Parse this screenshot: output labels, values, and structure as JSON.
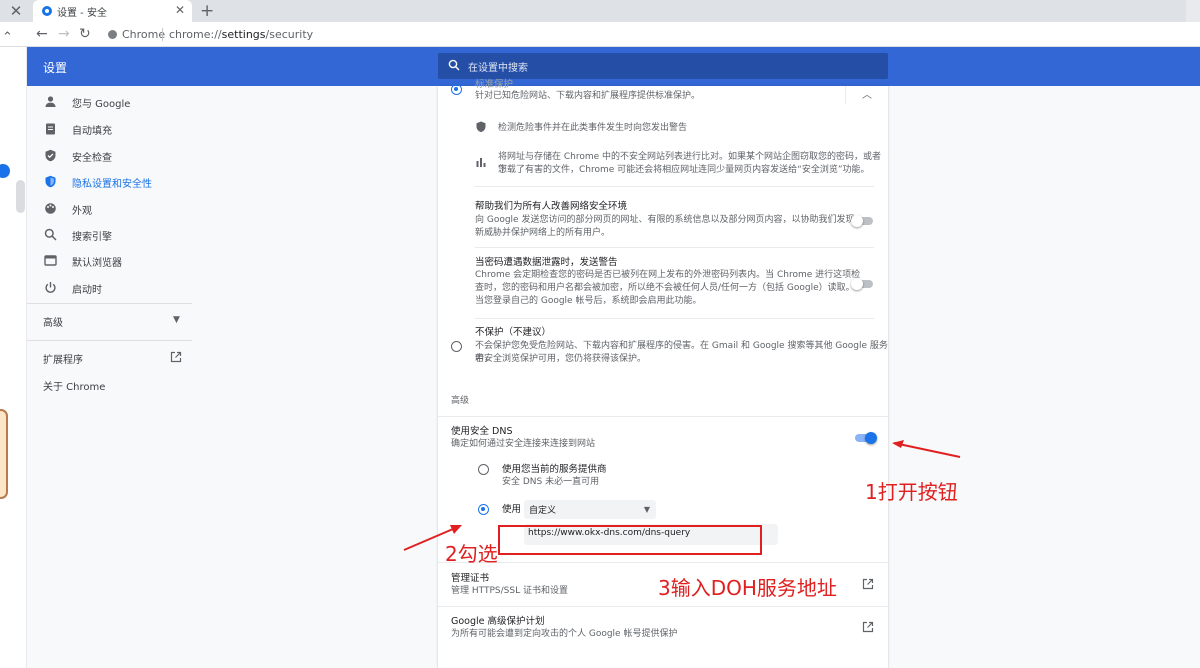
{
  "browser": {
    "tab_title": "设置 - 安全",
    "new_tab_symbol": "+",
    "close_symbol": "✕",
    "omnibox": {
      "site": "Chrome",
      "url_prefix": "chrome://",
      "url_path": "settings",
      "url_suffix": "/security"
    }
  },
  "header": {
    "title": "设置",
    "search_placeholder": "在设置中搜索"
  },
  "sidebar": {
    "items": [
      {
        "label": "您与 Google",
        "icon": "person-icon"
      },
      {
        "label": "自动填充",
        "icon": "clipboard-icon"
      },
      {
        "label": "安全检查",
        "icon": "shield-check-icon"
      },
      {
        "label": "隐私设置和安全性",
        "icon": "shield-icon",
        "active": true
      },
      {
        "label": "外观",
        "icon": "palette-icon"
      },
      {
        "label": "搜索引擎",
        "icon": "search-icon"
      },
      {
        "label": "默认浏览器",
        "icon": "browser-icon"
      },
      {
        "label": "启动时",
        "icon": "power-icon"
      }
    ],
    "advanced": "高级",
    "extensions": "扩展程序",
    "about": "关于 Chrome"
  },
  "security": {
    "standard": {
      "title_partial": "标准保护",
      "desc": "针对已知危险网站、下载内容和扩展程序提供标准保护。",
      "bullet1": "检测危险事件并在此类事件发生时向您发出警告",
      "bullet2_line1": "将网址与存储在 Chrome 中的不安全网站列表进行比对。如果某个网站企图窃取您的密码，或者您",
      "bullet2_line2": "下载了有害的文件，Chrome 可能还会将相应网址连同少量网页内容发送给“安全浏览”功能。"
    },
    "help_improve": {
      "title": "帮助我们为所有人改善网络安全环境",
      "line1": "向 Google 发送您访问的部分网页的网址、有限的系统信息以及部分网页内容，以协助我们发现",
      "line2": "新威胁并保护网络上的所有用户。"
    },
    "password_warn": {
      "title": "当密码遭遇数据泄露时，发送警告",
      "line1": "Chrome 会定期检查您的密码是否已被列在网上发布的外泄密码列表内。当 Chrome 进行这项检",
      "line2": "查时，您的密码和用户名都会被加密，所以绝不会被任何人员/任何一方（包括 Google）读取。",
      "line3": "当您登录自己的 Google 帐号后，系统即会启用此功能。"
    },
    "no_protection": {
      "title": "不保护（不建议）",
      "line1": "不会保护您免受危险网站、下载内容和扩展程序的侵害。在 Gmail 和 Google 搜索等其他 Google 服务中，",
      "line2": "若安全浏览保护可用，您仍将获得该保护。"
    },
    "advanced_heading": "高级",
    "secure_dns": {
      "title": "使用安全 DNS",
      "desc": "确定如何通过安全连接来连接到网站",
      "enabled": true,
      "opt_current": "使用您当前的服务提供商",
      "opt_current_desc": "安全 DNS 未必一直可用",
      "opt_custom": "使用",
      "select_value": "自定义",
      "custom_url": "https://www.okx-dns.com/dns-query"
    },
    "manage_certs": {
      "title": "管理证书",
      "desc": "管理 HTTPS/SSL 证书和设置"
    },
    "advanced_protection": {
      "title": "Google 高级保护计划",
      "desc": "为所有可能会遭到定向攻击的个人 Google 帐号提供保护"
    }
  },
  "annotations": {
    "step1": "1打开按钮",
    "step2": "2勾选",
    "step3": "3输入DOH服务地址",
    "color": "#e02020"
  }
}
